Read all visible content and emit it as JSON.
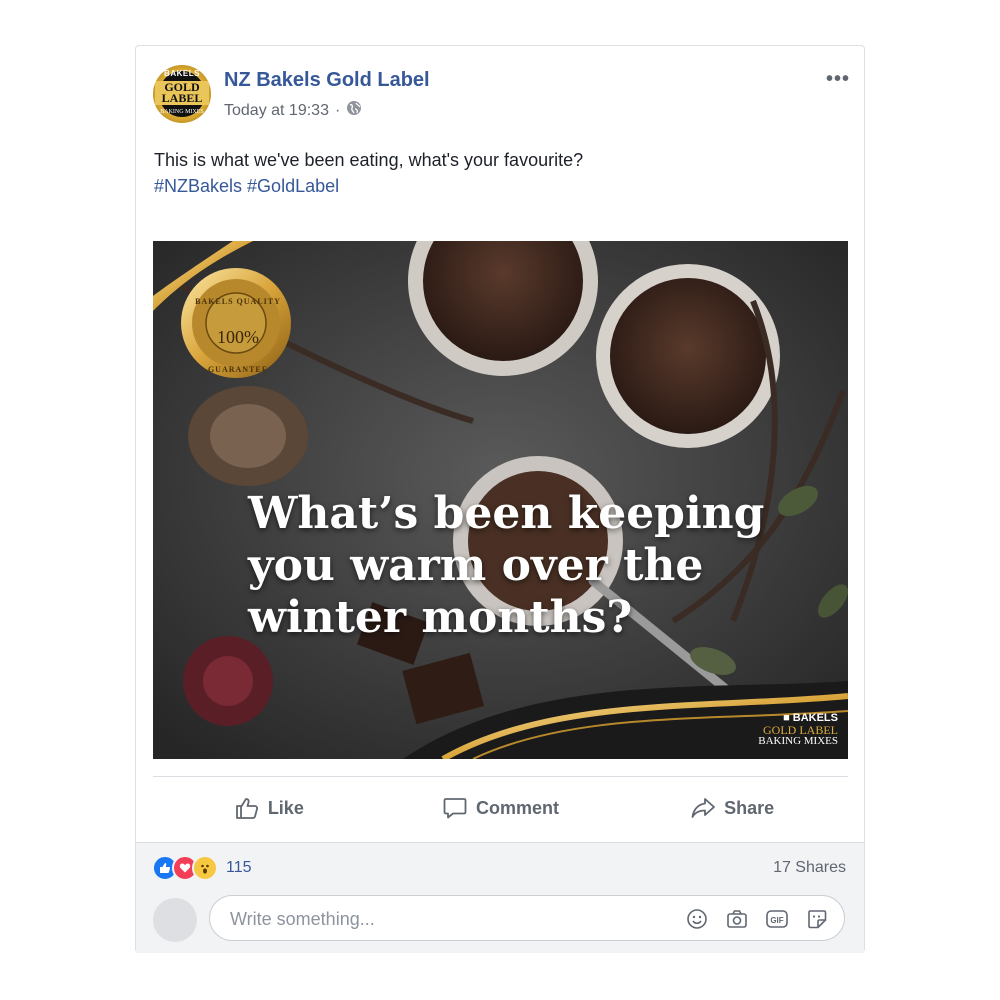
{
  "post": {
    "page_name": "NZ Bakels Gold Label",
    "timestamp": "Today at 19:33",
    "separator": "·",
    "privacy_icon": "globe-icon",
    "more_label": "•••",
    "text_line1": "This is what we've been eating, what's your favourite?",
    "hashtags": [
      "#NZBakels",
      "#GoldLabel"
    ],
    "avatar": {
      "brand": "BAKELS",
      "gold_label": "GOLD LABEL",
      "mixes": "BAKING MIXES"
    }
  },
  "image": {
    "headline_line1": "What’s been keeping",
    "headline_line2": "you warm over the",
    "headline_line3": "winter months?",
    "badge_top": "BAKELS QUALITY",
    "badge_center": "100%",
    "badge_bottom": "GUARANTEE",
    "brand_small": "■ BAKELS",
    "brand_gold": "GOLD LABEL",
    "brand_mixes": "BAKING MIXES"
  },
  "actions": {
    "like": "Like",
    "comment": "Comment",
    "share": "Share"
  },
  "footer": {
    "reaction_count": "115",
    "shares": "17 Shares",
    "comment_placeholder": "Write something...",
    "comment_icons": [
      "smiley-icon",
      "camera-icon",
      "gif-icon",
      "sticker-icon"
    ]
  },
  "colors": {
    "link": "#365899",
    "gold": "#d9ac3d",
    "like_blue": "#1877f2",
    "love_red": "#f33e58"
  }
}
